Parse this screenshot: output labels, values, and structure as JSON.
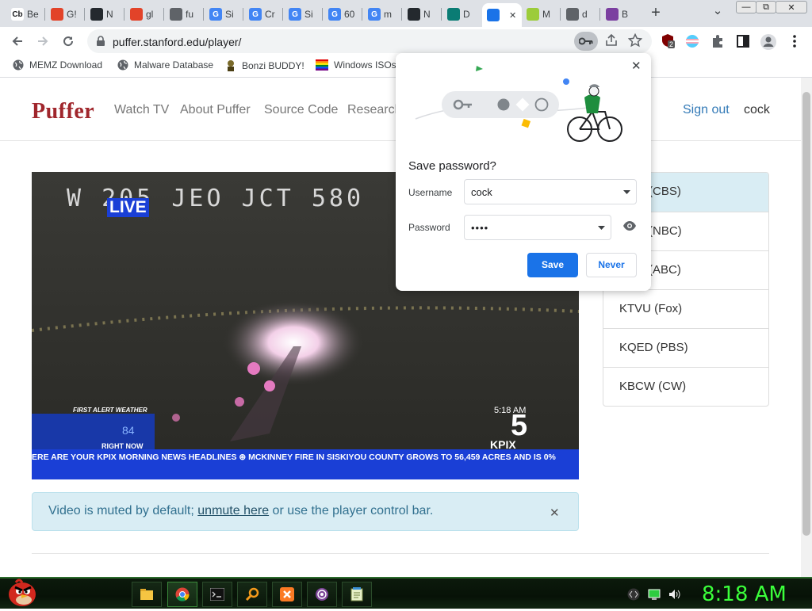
{
  "tabs": [
    {
      "label": "Be",
      "icon": "cb-icon",
      "badge": "Cb",
      "color": "#ffffff"
    },
    {
      "label": "G!",
      "icon": "gitlab-icon",
      "badge": "",
      "color": "#e24329"
    },
    {
      "label": "N",
      "icon": "github-icon",
      "badge": "",
      "color": "#24292e"
    },
    {
      "label": "gl",
      "icon": "gitlab-icon",
      "badge": "",
      "color": "#e24329"
    },
    {
      "label": "fu",
      "icon": "globe-icon",
      "badge": "",
      "color": "#5f6368"
    },
    {
      "label": "Si",
      "icon": "google-icon",
      "badge": "G",
      "color": "#4285f4"
    },
    {
      "label": "Cr",
      "icon": "google-icon",
      "badge": "G",
      "color": "#4285f4"
    },
    {
      "label": "Si",
      "icon": "google-icon",
      "badge": "G",
      "color": "#4285f4"
    },
    {
      "label": "60",
      "icon": "google-icon",
      "badge": "G",
      "color": "#4285f4"
    },
    {
      "label": "m",
      "icon": "google-icon",
      "badge": "G",
      "color": "#4285f4"
    },
    {
      "label": "N",
      "icon": "github-icon",
      "badge": "",
      "color": "#24292e"
    },
    {
      "label": "D",
      "icon": "teal-app-icon",
      "badge": "",
      "color": "#0a7c74"
    },
    {
      "label": "",
      "icon": "tv-icon",
      "badge": "",
      "color": "#1a73e8"
    },
    {
      "label": "M",
      "icon": "arch-icon",
      "badge": "",
      "color": "#9ccc3a"
    },
    {
      "label": "d",
      "icon": "globe-icon",
      "badge": "",
      "color": "#5f6368"
    },
    {
      "label": "B",
      "icon": "bonzi-icon",
      "badge": "",
      "color": "#7b3fa0"
    }
  ],
  "window": {
    "minimize": "—",
    "restore": "⧉",
    "close": "✕",
    "new_tab": "+",
    "tab_menu": "⌄"
  },
  "address": {
    "url": "puffer.stanford.edu/player/"
  },
  "extensions": {
    "badge_count": "2"
  },
  "bookmarks": [
    {
      "label": "MEMZ Download",
      "icon": "globe-icon"
    },
    {
      "label": "Malware Database",
      "icon": "globe-icon"
    },
    {
      "label": "Bonzi BUDDY!",
      "icon": "bonzi-icon"
    },
    {
      "label": "Windows ISOs",
      "icon": "windows-flag-icon"
    }
  ],
  "site": {
    "logo": "Puffer",
    "nav": [
      "Watch TV",
      "About Puffer",
      "Source Code",
      "Research"
    ],
    "sign_out": "Sign out",
    "user": "cock"
  },
  "video": {
    "caption_top": "W 205 JEO JCT 580",
    "live_badge": "LIVE",
    "first_alert": "FIRST ALERT WEATHER",
    "right_now": "RIGHT NOW",
    "temp": "84",
    "time": "5:18 AM",
    "station_num": "5",
    "station": "KPIX",
    "ticker": "ERE ARE YOUR KPIX MORNING NEWS HEADLINES ⊛ MCKINNEY FIRE IN SISKIYOU COUNTY GROWS TO 56,459 ACRES AND IS 0%"
  },
  "channels": [
    "(CBS)",
    "(NBC)",
    "(ABC)",
    "KTVU (Fox)",
    "KQED (PBS)",
    "KBCW (CW)"
  ],
  "alert": {
    "before": "Video is muted by default; ",
    "link": "unmute here",
    "after": " or use the player control bar.",
    "close": "✕"
  },
  "dialog": {
    "title": "Save password?",
    "username_label": "Username",
    "username_value": "cock",
    "password_label": "Password",
    "password_value": "••••",
    "save": "Save",
    "never": "Never",
    "close": "✕"
  },
  "taskbar": {
    "clock": "8:18 AM",
    "apps": [
      "file-explorer-icon",
      "chrome-icon",
      "cmd-icon",
      "search-icon",
      "xampp-icon",
      "tor-icon",
      "notepad-icon"
    ]
  },
  "colors": {
    "brand": "#a0262c",
    "link": "#337ab7",
    "save_button": "#1a73e8",
    "clock": "#3bff3b"
  }
}
